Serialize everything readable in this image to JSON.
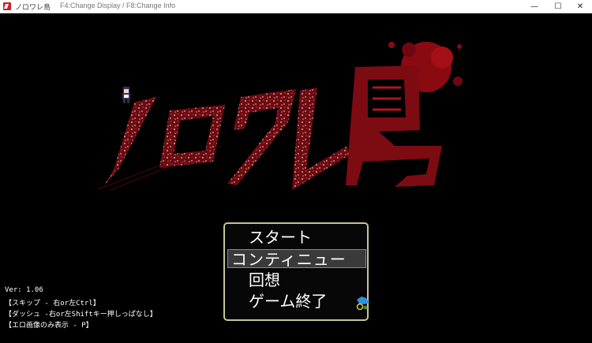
{
  "window": {
    "title": "ノロワレ島",
    "hint": "F4:Change Display / F8:Change Info",
    "minimize_glyph": "—",
    "maximize_glyph": "☐",
    "close_glyph": "✕"
  },
  "game": {
    "logo_icon": "blood-splatter-title-logo",
    "logo_text": "ノロワレ島",
    "menu": {
      "items": [
        "スタート",
        "コンティニュー",
        "回想",
        "ゲーム終了"
      ],
      "selected_index": 1
    },
    "info_lines": [
      "Ver: 1.06",
      "【スキップ - 右or左Ctrl】",
      "【ダッシュ -右or左Shiftキー押しっぱなし】",
      "【エロ画像のみ表示 - P】"
    ]
  },
  "colors": {
    "blood_red": "#7a0c12",
    "menu_border": "#c9c39a",
    "selected_bg": "#3a3a3a"
  }
}
